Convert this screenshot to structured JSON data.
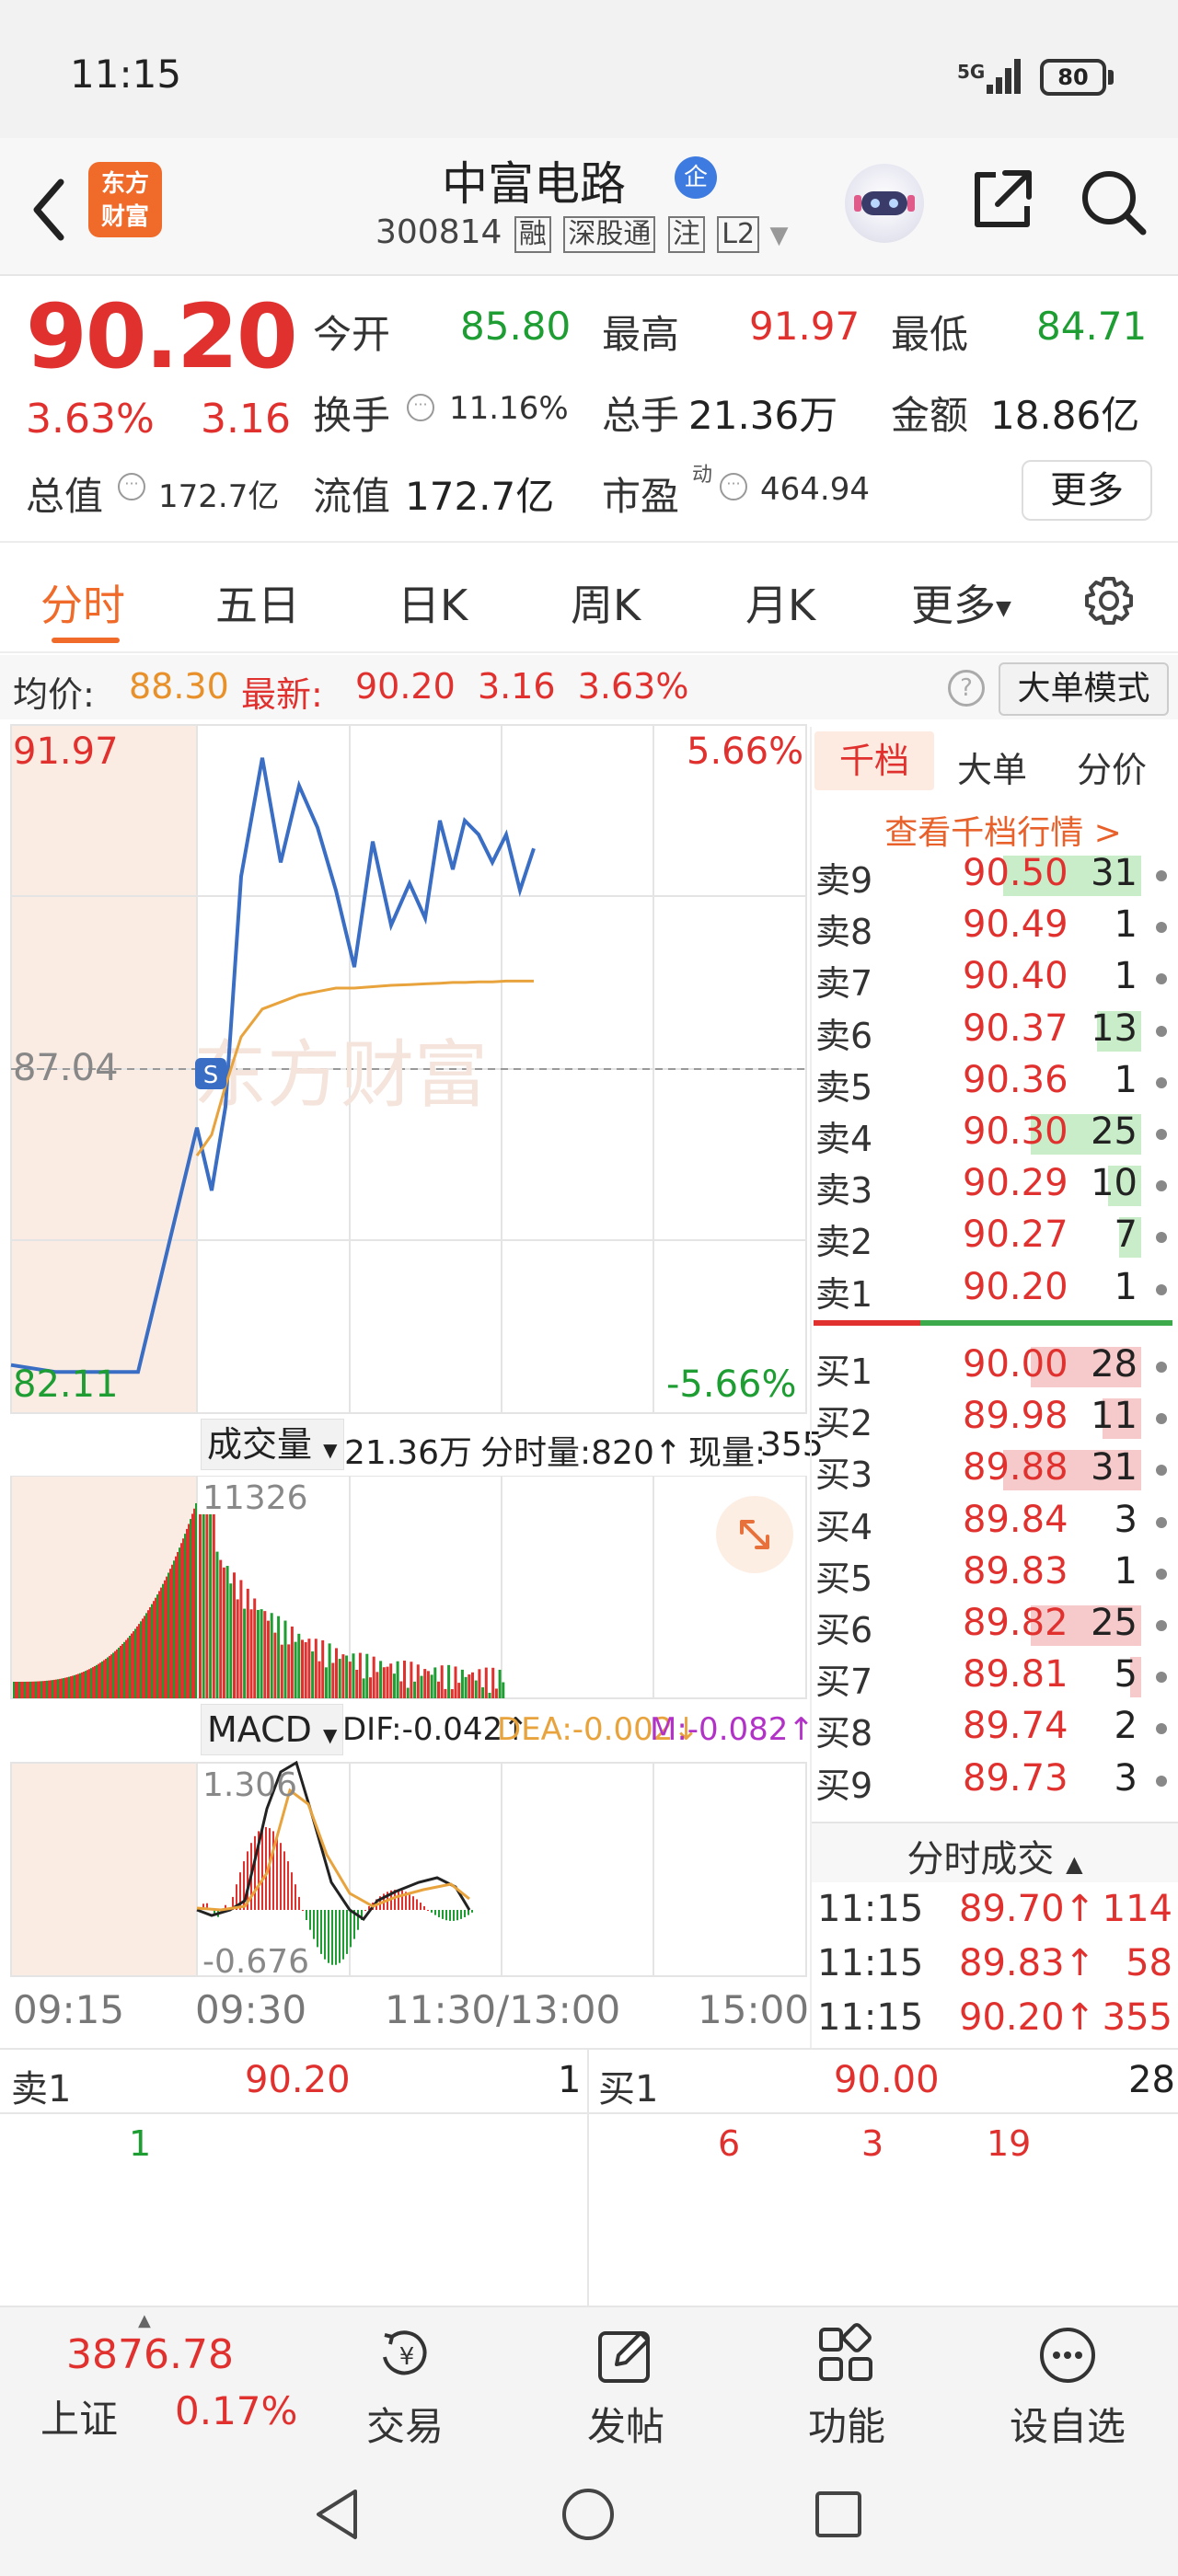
{
  "status": {
    "time": "11:15",
    "network": "5G",
    "battery": "80"
  },
  "header": {
    "logo_line1": "东方",
    "logo_line2": "财富",
    "stock_name": "中富电路",
    "badge": "企",
    "code": "300814",
    "tags": [
      "融",
      "深股通",
      "注",
      "L2"
    ]
  },
  "quote": {
    "price": "90.20",
    "change_pct": "3.63%",
    "change": "3.16",
    "open_label": "今开",
    "open": "85.80",
    "high_label": "最高",
    "high": "91.97",
    "low_label": "最低",
    "low": "84.71",
    "turnover_label": "换手",
    "turnover": "11.16%",
    "volume_label": "总手",
    "volume": "21.36万",
    "amount_label": "金额",
    "amount": "18.86亿",
    "mktcap_label": "总值",
    "mktcap": "172.7亿",
    "float_label": "流值",
    "float": "172.7亿",
    "pe_label": "市盈",
    "pe_sup": "动",
    "pe": "464.94",
    "more": "更多"
  },
  "tabs": [
    "分时",
    "五日",
    "日K",
    "周K",
    "月K",
    "更多"
  ],
  "info": {
    "avg_label": "均价:",
    "avg": "88.30",
    "latest_label": "最新:",
    "latest": "90.20",
    "latest_chg": "3.16",
    "latest_pct": "3.63%",
    "big_order": "大单模式"
  },
  "chart": {
    "y_max": "91.97",
    "y_mid": "87.04",
    "y_min": "82.11",
    "pct_max": "5.66%",
    "pct_min": "-5.66%",
    "watermark": "东方财富",
    "s_marker": "S",
    "vol_selector": "成交量",
    "vol_total": "21.36万",
    "vol_minute": "分时量:820↑",
    "vol_now_label": "现量:",
    "vol_now": "355",
    "vol_max": "11326",
    "macd_selector": "MACD",
    "dif": "DIF:-0.042↑",
    "dea": "DEA:-0.002↓",
    "m": "M:-0.082↑",
    "macd_max": "1.306",
    "macd_min": "-0.676",
    "times": [
      "09:15",
      "09:30",
      "11:30/13:00",
      "15:00"
    ],
    "colors": {
      "up": "#e0312f",
      "down": "#1e9d33",
      "price_line": "#3a6ec4",
      "avg_line": "#e8a33c"
    }
  },
  "chart_data": {
    "type": "line",
    "title": "",
    "xlabel": "",
    "ylabel": "",
    "ylim": [
      82.11,
      91.97
    ],
    "x": [
      "09:15",
      "09:20",
      "09:25",
      "09:30",
      "09:33",
      "09:36",
      "09:40",
      "09:45",
      "09:50",
      "09:55",
      "10:00",
      "10:05",
      "10:10",
      "10:15",
      "10:20",
      "10:25",
      "10:30",
      "10:35",
      "10:40",
      "10:45",
      "10:50",
      "10:55",
      "11:00",
      "11:05",
      "11:10",
      "11:15"
    ],
    "series": [
      {
        "name": "price",
        "values": [
          82.8,
          82.7,
          82.7,
          86.2,
          85.3,
          86.5,
          89.8,
          91.5,
          90.0,
          91.1,
          90.5,
          89.6,
          88.5,
          90.3,
          89.1,
          89.7,
          89.2,
          90.6,
          89.9,
          90.6,
          90.4,
          90.0,
          90.4,
          89.6,
          90.0,
          90.2
        ]
      },
      {
        "name": "average",
        "values": [
          null,
          null,
          null,
          85.8,
          86.1,
          86.8,
          87.5,
          87.9,
          88.0,
          88.1,
          88.15,
          88.2,
          88.2,
          88.22,
          88.24,
          88.25,
          88.26,
          88.27,
          88.28,
          88.28,
          88.29,
          88.29,
          88.3,
          88.3,
          88.3,
          88.3
        ]
      }
    ]
  },
  "orderbook": {
    "tabs": [
      "千档",
      "大单",
      "分价"
    ],
    "link": "查看千档行情 >",
    "asks": [
      {
        "label": "卖9",
        "price": "90.50",
        "qty": "31",
        "bar": 0.25
      },
      {
        "label": "卖8",
        "price": "90.49",
        "qty": "1",
        "bar": 0
      },
      {
        "label": "卖7",
        "price": "90.40",
        "qty": "1",
        "bar": 0
      },
      {
        "label": "卖6",
        "price": "90.37",
        "qty": "13",
        "bar": 0.08
      },
      {
        "label": "卖5",
        "price": "90.36",
        "qty": "1",
        "bar": 0
      },
      {
        "label": "卖4",
        "price": "90.30",
        "qty": "25",
        "bar": 0.2
      },
      {
        "label": "卖3",
        "price": "90.29",
        "qty": "10",
        "bar": 0.06
      },
      {
        "label": "卖2",
        "price": "90.27",
        "qty": "7",
        "bar": 0.04
      },
      {
        "label": "卖1",
        "price": "90.20",
        "qty": "1",
        "bar": 0
      }
    ],
    "bids": [
      {
        "label": "买1",
        "price": "90.00",
        "qty": "28",
        "bar": 0.2
      },
      {
        "label": "买2",
        "price": "89.98",
        "qty": "11",
        "bar": 0.07
      },
      {
        "label": "买3",
        "price": "89.88",
        "qty": "31",
        "bar": 0.25
      },
      {
        "label": "买4",
        "price": "89.84",
        "qty": "3",
        "bar": 0
      },
      {
        "label": "买5",
        "price": "89.83",
        "qty": "1",
        "bar": 0
      },
      {
        "label": "买6",
        "price": "89.82",
        "qty": "25",
        "bar": 0.2
      },
      {
        "label": "买7",
        "price": "89.81",
        "qty": "5",
        "bar": 0.02
      },
      {
        "label": "买8",
        "price": "89.74",
        "qty": "2",
        "bar": 0
      },
      {
        "label": "买9",
        "price": "89.73",
        "qty": "3",
        "bar": 0
      }
    ],
    "ticks_title": "分时成交",
    "ticks": [
      {
        "time": "11:15",
        "price": "89.70↑",
        "vol": "114"
      },
      {
        "time": "11:15",
        "price": "89.83↑",
        "vol": "58"
      },
      {
        "time": "11:15",
        "price": "90.20↑",
        "vol": "355"
      }
    ]
  },
  "queue": {
    "sell_label": "卖1",
    "sell_price": "90.20",
    "sell_qty": "1",
    "buy_label": "买1",
    "buy_price": "90.00",
    "buy_qty": "28",
    "sell_orders": [
      "1"
    ],
    "buy_orders": [
      "6",
      "3",
      "19"
    ]
  },
  "bottom_nav": {
    "index_value": "3876.78",
    "index_name": "上证",
    "index_pct": "0.17%",
    "items": [
      "交易",
      "发帖",
      "功能",
      "设自选"
    ]
  }
}
